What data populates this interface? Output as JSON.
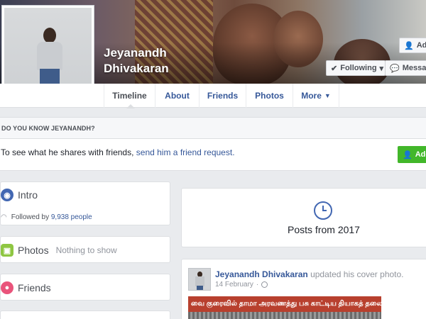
{
  "profile": {
    "name": "Jeyanandh Dhivakaran",
    "buttons": {
      "add_top": "Add",
      "following": "Following",
      "message": "Message"
    }
  },
  "nav": {
    "tabs": [
      "Timeline",
      "About",
      "Friends",
      "Photos",
      "More"
    ]
  },
  "know": {
    "header": "DO YOU KNOW JEYANANDH?",
    "text_before": "To see what he shares with friends,",
    "link": "send him a friend request.",
    "add_button": "Add"
  },
  "intro": {
    "title": "Intro",
    "followed_by_prefix": "Followed by",
    "followers_link": "9,938 people"
  },
  "photos": {
    "title": "Photos",
    "empty": "Nothing to show"
  },
  "friends": {
    "title": "Friends"
  },
  "posts_year": {
    "label": "Posts from 2017"
  },
  "post": {
    "author": "Jeyanandh Dhivakaran",
    "action": "updated his cover photo.",
    "date": "14 February",
    "image_text": "வை குரைவில் தாமா அரவணத்து பசு காட்டிய தியாகத் தலைவி சின்னம்மா"
  },
  "colors": {
    "link": "#365899",
    "green": "#42b72a",
    "intro_icon": "#4267b2",
    "photos_icon": "#8ec642",
    "friends_icon": "#e9547b"
  }
}
